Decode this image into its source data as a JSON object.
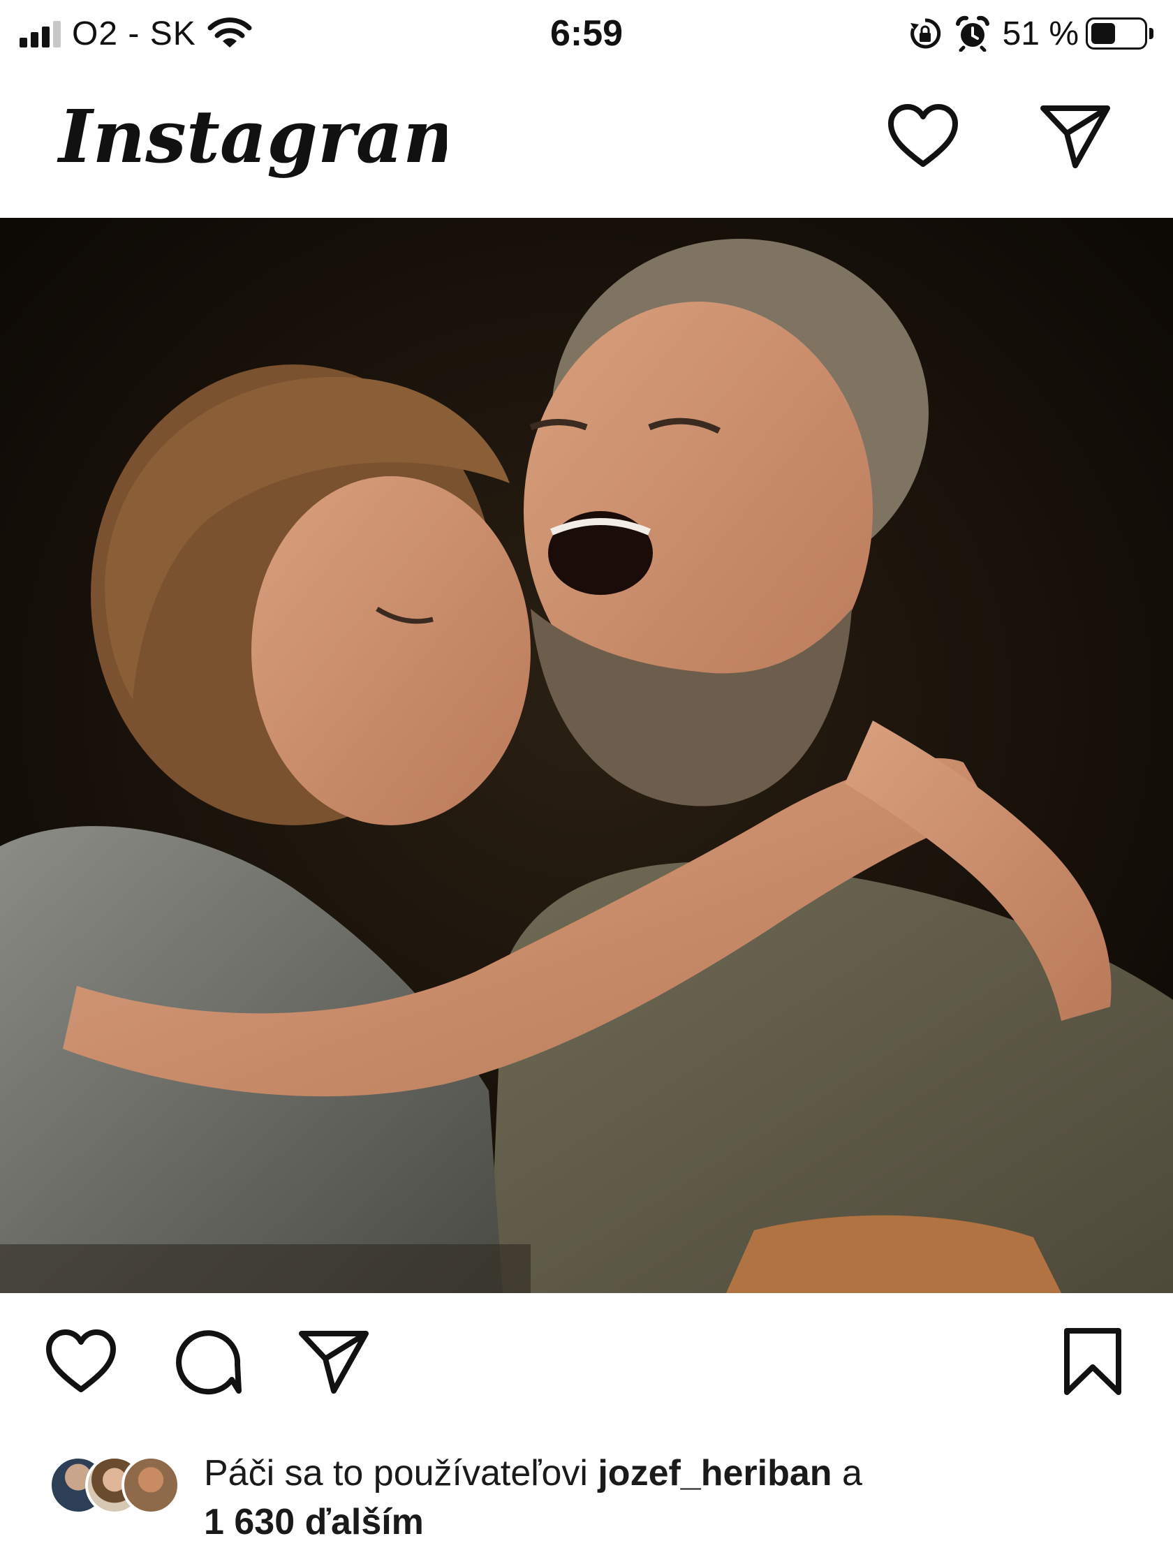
{
  "status_bar": {
    "carrier": "O2 - SK",
    "time": "6:59",
    "battery_percent": "51 %",
    "battery_level": 0.51,
    "icons": [
      "signal-icon",
      "wifi-icon",
      "orientation-lock-icon",
      "alarm-icon",
      "battery-icon"
    ]
  },
  "header": {
    "logo_text": "Instagram",
    "icons": [
      "heart-icon",
      "direct-message-icon"
    ]
  },
  "post": {
    "image_alt": "photo"
  },
  "actions": {
    "icons": [
      "like-heart-icon",
      "comment-icon",
      "share-icon",
      "bookmark-icon"
    ]
  },
  "likes": {
    "prefix": "Páči sa to používateľovi ",
    "user": "jozef_heriban",
    "connector": " a",
    "count": "1 630 ďalším"
  }
}
